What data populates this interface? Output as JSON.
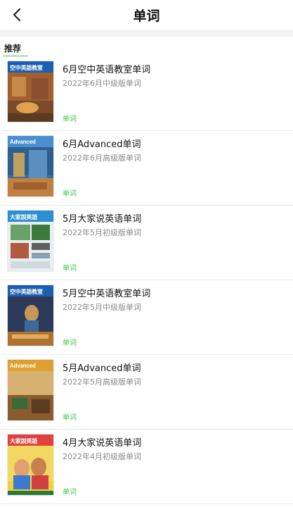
{
  "header": {
    "title": "单词",
    "back_icon": "chevron-left-icon"
  },
  "tabs": [
    {
      "label": "推荐",
      "active": true
    }
  ],
  "colors": {
    "accent": "#3cc84a",
    "subtitle": "#8a8a8a"
  },
  "items": [
    {
      "title": "6月空中英语教室单词",
      "subtitle": "2022年6月中级版单词",
      "action": "单词",
      "cover_text": "空中英語教室"
    },
    {
      "title": "6月Advanced单词",
      "subtitle": "2022年6月高级版单词",
      "action": "单词",
      "cover_text": "Advanced"
    },
    {
      "title": "5月大家说英语单词",
      "subtitle": "2022年5月初级版单词",
      "action": "单词",
      "cover_text": "大家說英語"
    },
    {
      "title": "5月空中英语教室单词",
      "subtitle": "2022年5月中级版单词",
      "action": "单词",
      "cover_text": "空中英語教室"
    },
    {
      "title": "5月Advanced单词",
      "subtitle": "2022年5月高级版单词",
      "action": "单词",
      "cover_text": "Advanced"
    },
    {
      "title": "4月大家说英语单词",
      "subtitle": "2022年4月初级版单词",
      "action": "单词",
      "cover_text": "大家說英語"
    }
  ]
}
